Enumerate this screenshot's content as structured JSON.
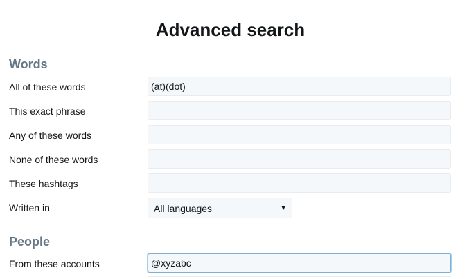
{
  "page": {
    "title": "Advanced search"
  },
  "words": {
    "heading": "Words",
    "rows": [
      {
        "label": "All of these words",
        "value": "(at)(dot)",
        "placeholder": ""
      },
      {
        "label": "This exact phrase",
        "value": "",
        "placeholder": ""
      },
      {
        "label": "Any of these words",
        "value": "",
        "placeholder": ""
      },
      {
        "label": "None of these words",
        "value": "",
        "placeholder": ""
      },
      {
        "label": "These hashtags",
        "value": "",
        "placeholder": ""
      }
    ],
    "language": {
      "label": "Written in",
      "selected": "All languages",
      "arrow_icon": "dropdown-arrow-icon"
    }
  },
  "people": {
    "heading": "People",
    "rows": [
      {
        "label": "From these accounts",
        "value": "@xyzabc",
        "placeholder": ""
      }
    ]
  },
  "colors": {
    "heading": "#657786",
    "text": "#14171a",
    "field_bg": "#f5f8fa",
    "field_border": "#e6ecf0",
    "focus_border": "#7fb2d2"
  }
}
